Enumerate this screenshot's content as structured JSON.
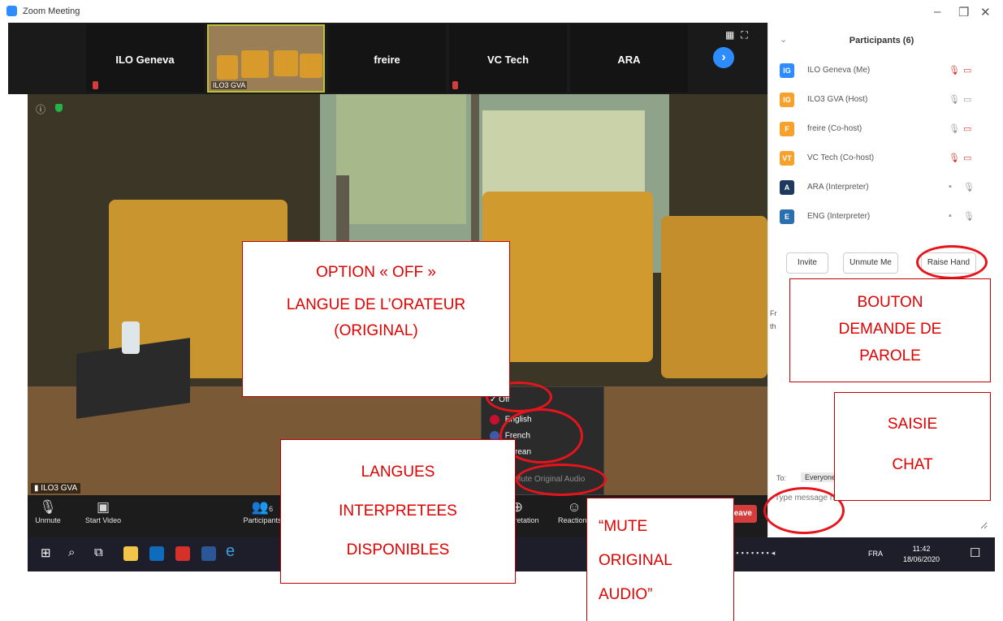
{
  "window": {
    "title": "Zoom Meeting",
    "minimize_icon": "minimize-icon",
    "restore_icon": "restore-icon",
    "close_icon": "close-icon"
  },
  "gallery": {
    "tiles": [
      {
        "name": "ILO Geneva",
        "muted": true
      },
      {
        "name": "ILO3 GVA",
        "muted": false,
        "active_speaker": true
      },
      {
        "name": "freire",
        "muted": false
      },
      {
        "name": "VC Tech",
        "muted": true
      },
      {
        "name": "ARA",
        "muted": false
      }
    ],
    "next_page_icon": "chevron-right-icon",
    "view_icons": [
      "grid-view-icon",
      "fullscreen-icon"
    ]
  },
  "main_video": {
    "name_label": "ILO3 GVA",
    "signal_icon": "signal-bars-icon",
    "info_icon": "info-icon",
    "security_icon": "shield-icon"
  },
  "controls": {
    "unmute": {
      "label": "Unmute",
      "icon": "microphone-muted-icon"
    },
    "start_video": {
      "label": "Start Video",
      "icon": "camera-off-icon"
    },
    "participants": {
      "label": "Participants",
      "count": "6",
      "icon": "participants-icon"
    },
    "interpretation": {
      "label": "Interpretation",
      "icon": "globe-icon"
    },
    "reactions": {
      "label": "Reactions",
      "icon": "smiley-icon"
    },
    "leave": {
      "label": "Leave"
    }
  },
  "interpretation_menu": {
    "off": "Off",
    "languages": [
      {
        "label": "English",
        "flag_color": "#c8102e"
      },
      {
        "label": "French",
        "flag_color": "#3d5aa8"
      },
      {
        "label": "Korean",
        "flag_color": "#9a9a9a"
      }
    ],
    "mute_original": "Mute Original Audio"
  },
  "participants_panel": {
    "title": "Participants (6)",
    "participants": [
      {
        "initials": "IG",
        "name": "ILO Geneva (Me)",
        "color": "#2d8cff",
        "mic": "muted",
        "video": "off"
      },
      {
        "initials": "IG",
        "name": "ILO3 GVA (Host)",
        "color": "#f6a12c",
        "mic": "on",
        "video": "on"
      },
      {
        "initials": "F",
        "name": "freire (Co-host)",
        "color": "#f6a12c",
        "mic": "on",
        "video": "off"
      },
      {
        "initials": "VT",
        "name": "VC Tech (Co-host)",
        "color": "#f6a12c",
        "mic": "muted",
        "video": "off"
      },
      {
        "initials": "A",
        "name": "ARA (Interpreter)",
        "color": "#1f3a5f",
        "mic": "on",
        "video": "none"
      },
      {
        "initials": "E",
        "name": "ENG (Interpreter)",
        "color": "#2a6fb0",
        "mic": "on",
        "video": "none"
      }
    ],
    "buttons": {
      "invite": "Invite",
      "unmute_me": "Unmute Me",
      "raise_hand": "Raise Hand"
    },
    "chat_peek": [
      "Fr",
      "th"
    ]
  },
  "chat": {
    "to_label": "To:",
    "to_value": "Everyone",
    "placeholder": "Type message here..."
  },
  "taskbar": {
    "apps": [
      "windows-start-icon",
      "search-icon",
      "task-view-icon",
      "file-explorer-icon",
      "outlook-icon",
      "acrobat-icon",
      "word-icon",
      "edge-icon"
    ],
    "language": "FRA",
    "time": "11:42",
    "date": "18/06/2020"
  },
  "annotations": {
    "off_option": [
      "OPTION « OFF »",
      "LANGUE DE L’ORATEUR",
      "(ORIGINAL)"
    ],
    "raise_hand": [
      "BOUTON",
      "DEMANDE DE",
      "PAROLE"
    ],
    "chat_input": [
      "SAISIE",
      "CHAT"
    ],
    "languages": [
      "LANGUES",
      "INTERPRETEES",
      "DISPONIBLES"
    ],
    "mute_original": [
      "“MUTE",
      "ORIGINAL",
      "AUDIO”"
    ]
  },
  "colors": {
    "zoom_blue": "#2d8cff",
    "annotation_red": "#e00000",
    "muted_red": "#d53c3c",
    "leave_red": "#d53c3c"
  }
}
